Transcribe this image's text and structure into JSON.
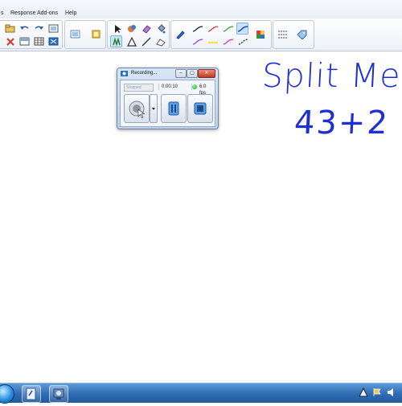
{
  "menubar": {
    "items": [
      "s",
      "Response",
      "Add-ons",
      "Help"
    ]
  },
  "toolbar": {
    "groups": [
      "file-tools",
      "view-tools",
      "draw-tools",
      "pen-styles",
      "colors",
      "properties"
    ],
    "selected_tools": [
      "select-object-tool",
      "pen-style-blue-wave"
    ]
  },
  "canvas": {
    "text_line_1": "Split Met",
    "text_line_2": "43+2",
    "ink_color": "#1f2fd6"
  },
  "recording_window": {
    "title": "Recording...",
    "source_dropdown": "Stopped",
    "elapsed_time": "0:00:10",
    "fps": "6.0 fps",
    "status_color": "#1aa41a",
    "buttons": [
      "record-button",
      "pause-button",
      "stop-button"
    ]
  },
  "taskbar": {
    "pinned": [
      "windows-start-icon",
      "notebook-app-icon",
      "recorder-app-icon"
    ]
  },
  "colors": {
    "menubar": "#e9eef6",
    "taskbar": "#2e6bb3",
    "window_frame": "#bcd2ea"
  }
}
